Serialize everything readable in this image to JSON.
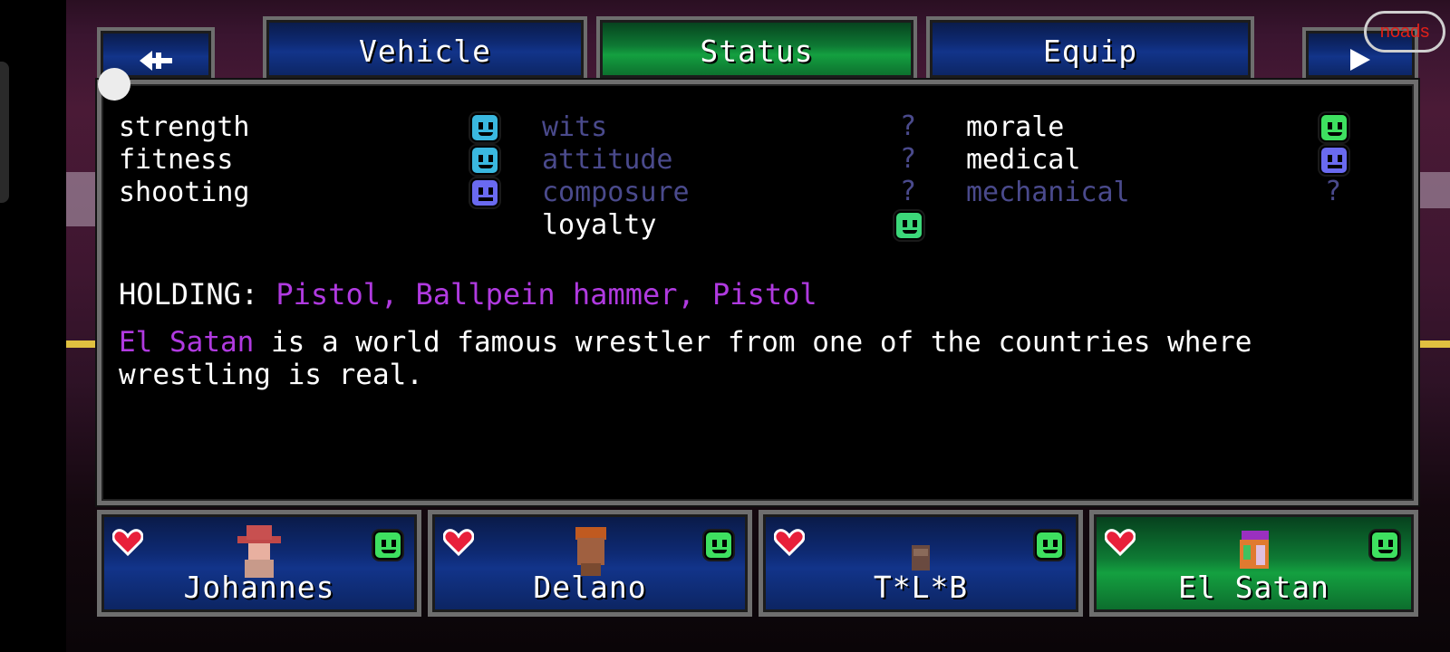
{
  "tabs": {
    "back_icon": "back-arrow-icon",
    "vehicle": "Vehicle",
    "status": "Status",
    "equip": "Equip",
    "next_icon": "play-arrow-icon",
    "active": "Status"
  },
  "noads": "noads",
  "stats": {
    "col1": [
      {
        "label": "strength",
        "mood": "cyan"
      },
      {
        "label": "fitness",
        "mood": "cyan"
      },
      {
        "label": "shooting",
        "mood": "purple"
      }
    ],
    "col2": [
      {
        "label": "wits",
        "mood": "?"
      },
      {
        "label": "attitude",
        "mood": "?"
      },
      {
        "label": "composure",
        "mood": "?"
      },
      {
        "label": "loyalty",
        "mood": "green"
      }
    ],
    "col3": [
      {
        "label": "morale",
        "mood": "lime"
      },
      {
        "label": "medical",
        "mood": "purple"
      },
      {
        "label": "mechanical",
        "mood": "?"
      }
    ],
    "unknown_mark": "?"
  },
  "holding": {
    "label": "HOLDING:",
    "items": "Pistol, Ballpein hammer, Pistol"
  },
  "bio": {
    "name": "El Satan",
    "text_line1": " is a world famous wrestler from one of the countries where",
    "text_line2": "wrestling is real."
  },
  "party": [
    {
      "name": "Johannes",
      "selected": false
    },
    {
      "name": "Delano",
      "selected": false
    },
    {
      "name": "T*L*B",
      "selected": false
    },
    {
      "name": "El Satan",
      "selected": true
    }
  ],
  "colors": {
    "accent_purple": "#b03ae0",
    "unknown_stat": "#4a4a8c",
    "heart": "#e8203a",
    "active_tab": "#14a040",
    "inactive_tab": "#12348a"
  }
}
